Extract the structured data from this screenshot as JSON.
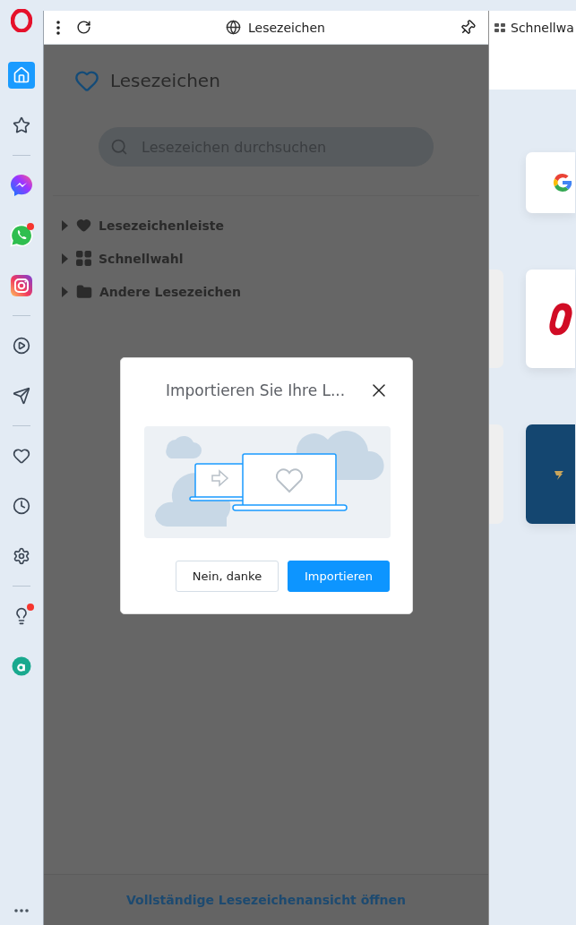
{
  "sidebar": {
    "items": [
      {
        "kind": "home",
        "selected": true,
        "badge": false
      },
      {
        "kind": "star",
        "selected": false,
        "badge": false
      },
      {
        "kind": "divider"
      },
      {
        "kind": "messenger",
        "selected": false,
        "badge": false
      },
      {
        "kind": "whatsapp",
        "selected": false,
        "badge": true
      },
      {
        "kind": "instagram",
        "selected": false,
        "badge": false
      },
      {
        "kind": "divider"
      },
      {
        "kind": "player",
        "selected": false,
        "badge": false
      },
      {
        "kind": "send",
        "selected": false,
        "badge": false
      },
      {
        "kind": "divider"
      },
      {
        "kind": "heart",
        "selected": false,
        "badge": false
      },
      {
        "kind": "clock",
        "selected": false,
        "badge": false
      },
      {
        "kind": "settings",
        "selected": false,
        "badge": false
      },
      {
        "kind": "divider"
      },
      {
        "kind": "bulb",
        "selected": false,
        "badge": true
      },
      {
        "kind": "aria",
        "selected": false,
        "badge": false
      }
    ]
  },
  "panel": {
    "toolbar_title": "Lesezeichen",
    "title": "Lesezeichen",
    "search": {
      "placeholder": "Lesezeichen durchsuchen"
    },
    "tree": [
      {
        "label": "Lesezeichenleiste",
        "kind": "heart",
        "expanded": false
      },
      {
        "label": "Schnellwahl",
        "kind": "grid",
        "expanded": false
      },
      {
        "label": "Andere Lesezeichen",
        "kind": "folder",
        "expanded": false
      }
    ],
    "footer_link": "Vollständige Lesezeichenansicht öffnen"
  },
  "dialog": {
    "title": "Importieren Sie Ihre L...",
    "buttons": [
      {
        "label": "Nein, danke",
        "primary": false
      },
      {
        "label": "Importieren",
        "primary": true
      }
    ]
  },
  "tab": {
    "label": "Schnellwa"
  },
  "speed_dial": [
    {
      "kind": "google"
    },
    {
      "kind": "opera"
    },
    {
      "kind": "blue"
    }
  ]
}
